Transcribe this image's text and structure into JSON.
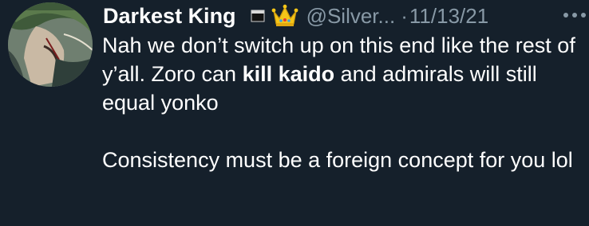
{
  "tweet": {
    "display_name": "Darkest King",
    "handle": "@Silver...",
    "separator": "·",
    "date": "11/13/21",
    "paragraph1": {
      "part1": "Nah we don’t switch up on this end like the rest of y’all. Zoro can ",
      "bold": "kill kaido",
      "part2": " and admirals will still equal yonko"
    },
    "paragraph2": "Consistency must be a foreign concept for you lol"
  },
  "icons": {
    "flag": "flag-icon",
    "crown": "crown-icon",
    "more": "more-options-icon"
  },
  "colors": {
    "background": "#15202b",
    "text": "#ffffff",
    "secondary_text": "#8899a6"
  }
}
